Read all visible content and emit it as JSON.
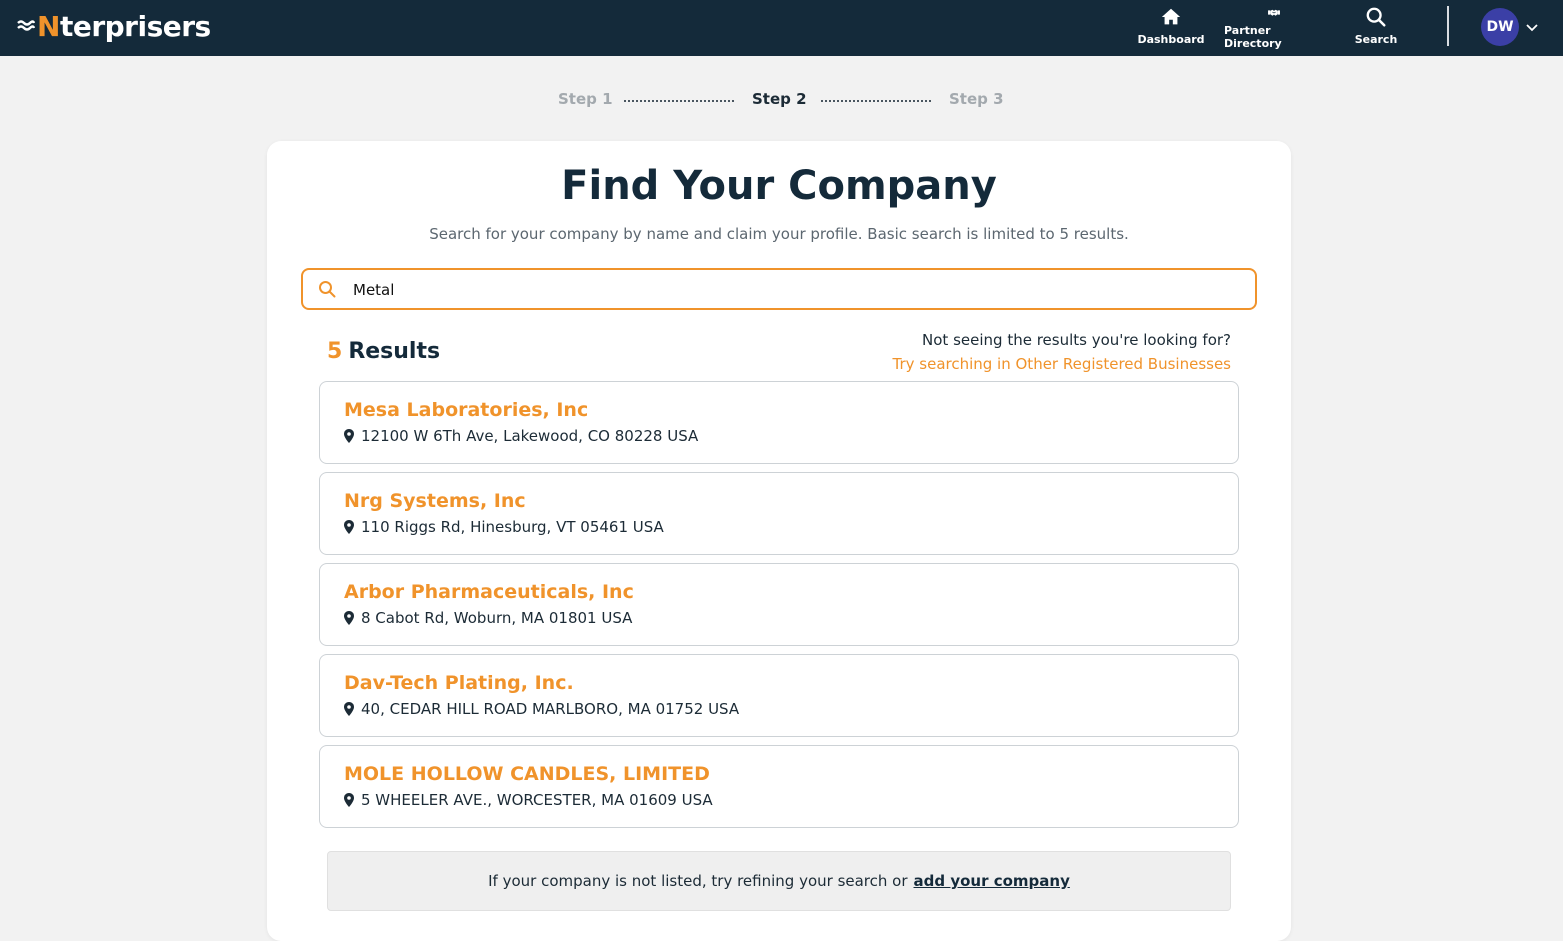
{
  "nav": {
    "logo_prefix": "N",
    "logo_rest": "terprisers",
    "dashboard_label": "Dashboard",
    "partners_label": "Partner Directory",
    "search_label": "Search",
    "avatar_initials": "DW"
  },
  "stepper": {
    "step1": "Step 1",
    "step2": "Step 2",
    "step3": "Step 3",
    "active_step": 2
  },
  "page": {
    "title": "Find Your Company",
    "subtitle": "Search for your company by name and claim your profile. Basic search is limited to 5 results.",
    "search_value": "Metal",
    "results_count": "5",
    "results_label": "Results",
    "not_seeing": "Not seeing the results you're looking for?",
    "try_link": "Try searching in Other Registered Businesses",
    "footer_text": "If your company is not listed, try refining your search or",
    "footer_link": "add your company"
  },
  "results": [
    {
      "name": "Mesa Laboratories, Inc",
      "address": "12100 W 6Th Ave, Lakewood, CO 80228 USA"
    },
    {
      "name": "Nrg Systems, Inc",
      "address": "110 Riggs Rd, Hinesburg, VT 05461 USA"
    },
    {
      "name": "Arbor Pharmaceuticals, Inc",
      "address": "8 Cabot Rd, Woburn, MA 01801 USA"
    },
    {
      "name": "Dav-Tech Plating, Inc.",
      "address": "40, CEDAR HILL ROAD MARLBORO, MA 01752 USA"
    },
    {
      "name": "MOLE HOLLOW CANDLES, LIMITED",
      "address": "5 WHEELER AVE., WORCESTER, MA 01609 USA"
    }
  ],
  "colors": {
    "navbar": "#142a3a",
    "accent": "#f0932b",
    "avatar": "#3b3fa6",
    "background": "#f2f2f2"
  },
  "icons": [
    "waves-logo-icon",
    "home-icon",
    "handshake-icon",
    "search-icon",
    "chevron-down-icon",
    "map-pin-icon"
  ]
}
